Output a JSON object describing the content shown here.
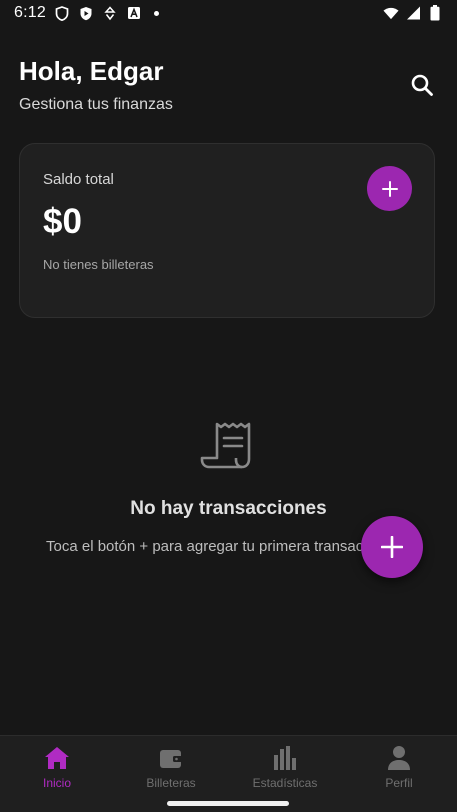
{
  "status_bar": {
    "time": "6:12",
    "icons": [
      "shield-icon",
      "play-protect-icon",
      "recycle-icon",
      "a-letter-icon",
      "notification-dot",
      "wifi-icon",
      "signal-icon",
      "battery-icon"
    ]
  },
  "header": {
    "greeting": "Hola, Edgar",
    "subtitle": "Gestiona tus finanzas",
    "search_icon": "search-icon"
  },
  "balance_card": {
    "label": "Saldo total",
    "amount": "$0",
    "note": "No tienes billeteras",
    "add_icon": "plus-icon"
  },
  "empty_state": {
    "icon": "receipt-icon",
    "title": "No hay transacciones",
    "hint": "Toca el botón + para agregar tu primera transacción"
  },
  "fab": {
    "icon": "plus-icon"
  },
  "bottom_nav": {
    "items": [
      {
        "label": "Inicio",
        "icon": "home-icon",
        "active": true
      },
      {
        "label": "Billeteras",
        "icon": "wallet-icon",
        "active": false
      },
      {
        "label": "Estadísticas",
        "icon": "bar-chart-icon",
        "active": false
      },
      {
        "label": "Perfil",
        "icon": "person-icon",
        "active": false
      }
    ]
  },
  "colors": {
    "background": "#171717",
    "card": "#202020",
    "accent": "#9c27b0",
    "nav_active": "#b02bc3",
    "nav_inactive": "#6f6f6f"
  }
}
